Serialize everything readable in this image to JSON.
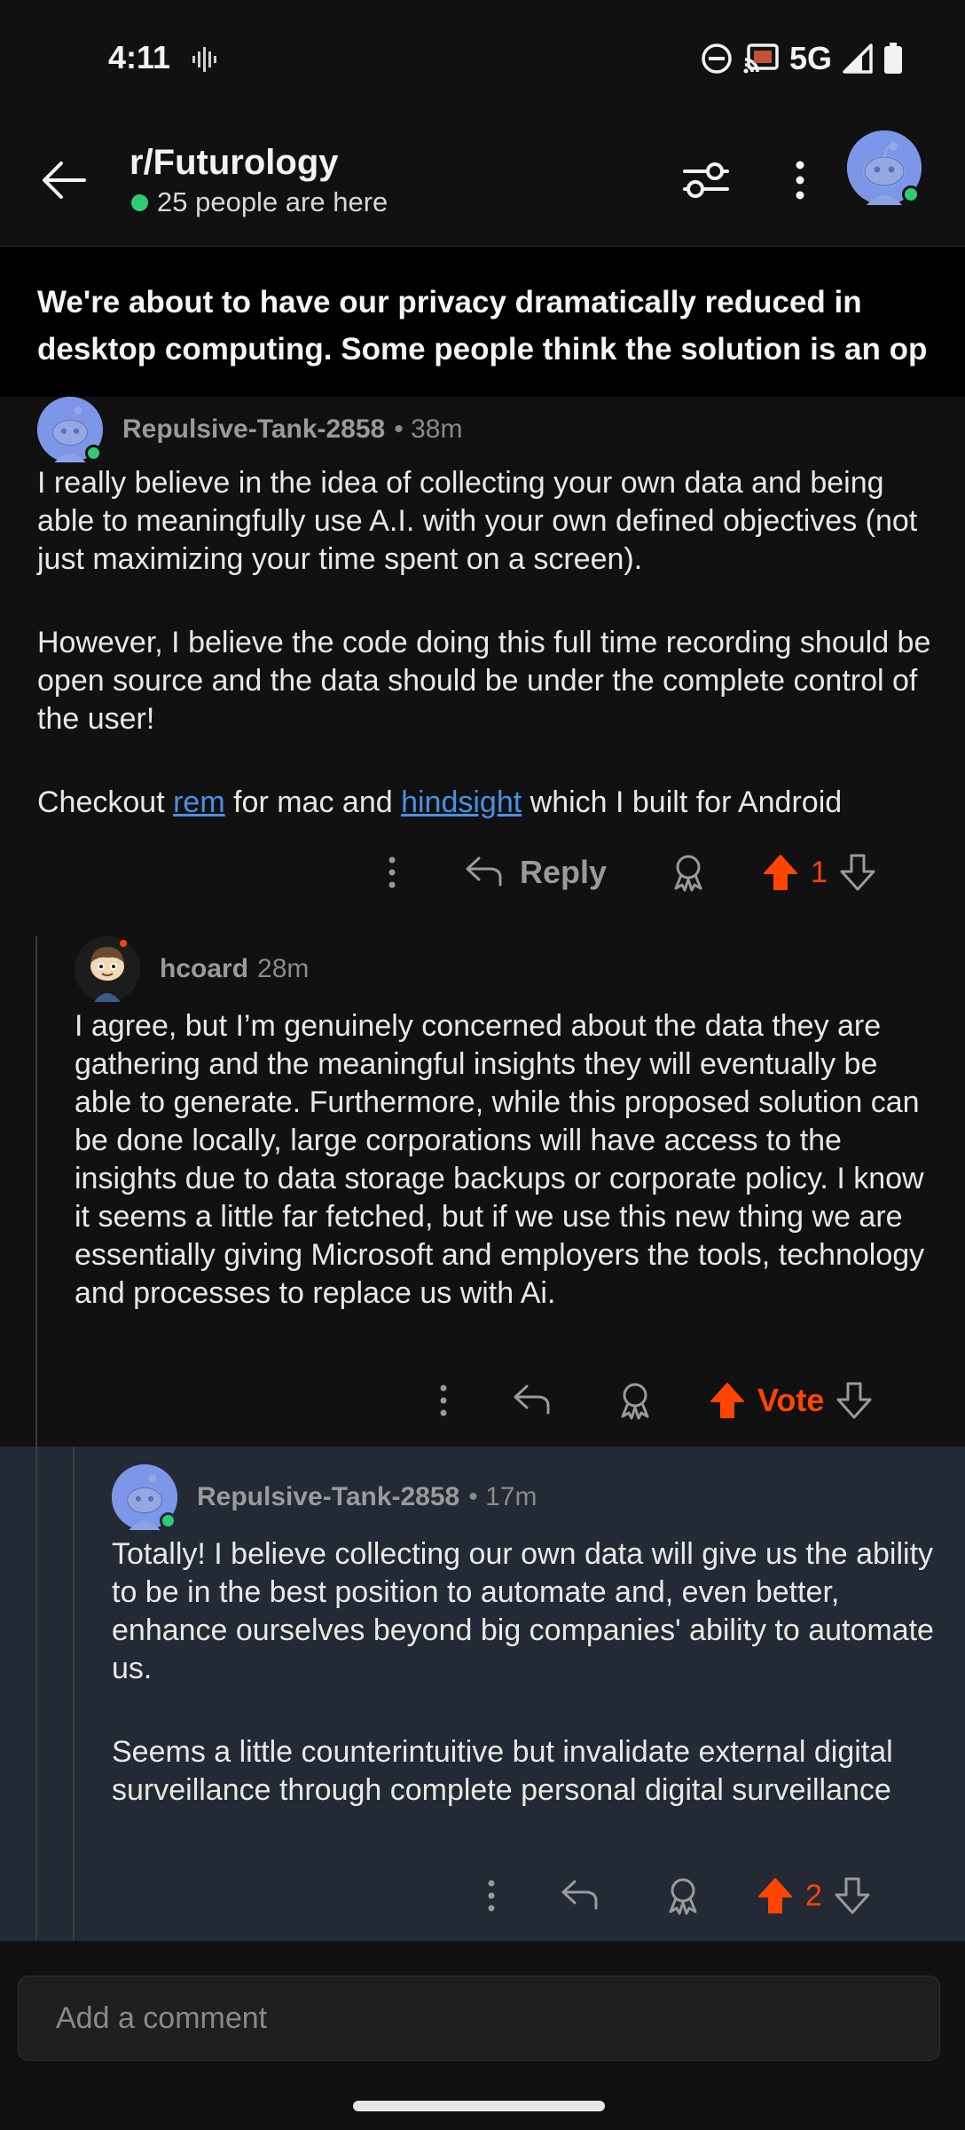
{
  "status_bar": {
    "time": "4:11",
    "network": "5G"
  },
  "header": {
    "subreddit": "r/Futurology",
    "presence": "25 people are here"
  },
  "post": {
    "title_line1": "We're about to have our privacy dramatically reduced in",
    "title_line2": "desktop computing. Some people think the solution is an op..."
  },
  "comments": [
    {
      "author": "Repulsive-Tank-2858",
      "meta": "• 38m",
      "paragraphs": [
        "I really believe in the idea of collecting your own data and being able to meaningfully use A.I. with your own defined objectives (not just maximizing your time spent on a screen).",
        "However, I believe the code doing this full time recording should be open source and the data should be under the complete control of the user!"
      ],
      "checkout": {
        "prefix": "Checkout ",
        "link1": "rem",
        "middle": " for mac and ",
        "link2": "hindsight",
        "suffix": " which I built for Android"
      },
      "reply_label": "Reply",
      "votes": "1"
    },
    {
      "author": "hcoard",
      "meta": "28m",
      "paragraphs": [
        "I agree, but I’m genuinely concerned about the data they are gathering and the meaningful insights they will eventually be able to generate. Furthermore, while this proposed solution can be done locally, large corporations will have access to the insights due to data storage backups or corporate policy. I know it seems a little far fetched, but if we use this new thing we are essentially giving Microsoft and employers the tools, technology and processes to replace us with Ai."
      ],
      "votes": "Vote"
    },
    {
      "author": "Repulsive-Tank-2858",
      "meta": "• 17m",
      "paragraphs": [
        "Totally! I believe collecting our own data will give us the ability to be in the best position to automate and, even better, enhance ourselves beyond big companies' ability to automate us.",
        "Seems a little counterintuitive but invalidate external digital surveillance through complete personal digital surveillance"
      ],
      "votes": "2"
    }
  ],
  "composer": {
    "placeholder": "Add a comment"
  },
  "colors": {
    "upvote": "#ff4500",
    "online": "#2ecc71",
    "link": "#4a90e2",
    "highlight_bg": "#232a35",
    "snoo_blue": "#7c96e8"
  }
}
